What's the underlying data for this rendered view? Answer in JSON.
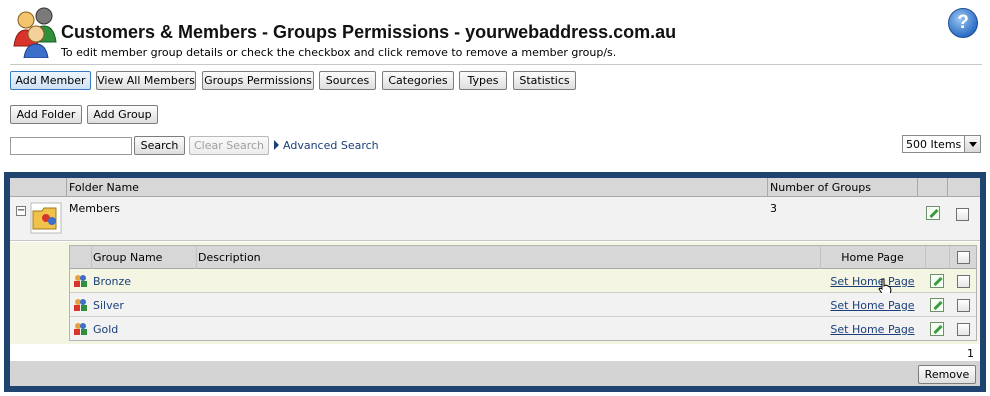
{
  "header": {
    "title": "Customers & Members - Groups Permissions - yourwebaddress.com.au",
    "subtitle": "To edit member group details or check the checkbox and click remove to remove a member group/s.",
    "help_label": "?"
  },
  "nav": {
    "add_member": "Add Member",
    "view_all_members": "View All Members",
    "groups_permissions": "Groups Permissions",
    "sources": "Sources",
    "categories": "Categories",
    "types": "Types",
    "statistics": "Statistics"
  },
  "actions": {
    "add_folder": "Add Folder",
    "add_group": "Add Group"
  },
  "search": {
    "value": "",
    "search_label": "Search",
    "clear_label": "Clear Search",
    "advanced_label": "Advanced Search",
    "items_per_page": "500 Items"
  },
  "folders_table": {
    "columns": {
      "folder_name": "Folder Name",
      "number_of_groups": "Number of Groups"
    },
    "folder": {
      "name": "Members",
      "count": "3",
      "collapse_symbol": "−"
    },
    "groups_table": {
      "columns": {
        "group_name": "Group Name",
        "description": "Description",
        "home_page": "Home Page"
      },
      "rows": [
        {
          "name": "Bronze",
          "description": "",
          "home_page": "Set Home Page"
        },
        {
          "name": "Silver",
          "description": "",
          "home_page": "Set Home Page"
        },
        {
          "name": "Gold",
          "description": "",
          "home_page": "Set Home Page"
        }
      ]
    },
    "page_number": "1",
    "remove_label": "Remove"
  },
  "colors": {
    "accent": "#1f4470",
    "link": "#1a3f7a",
    "row_highlight": "#f5f5e3"
  }
}
